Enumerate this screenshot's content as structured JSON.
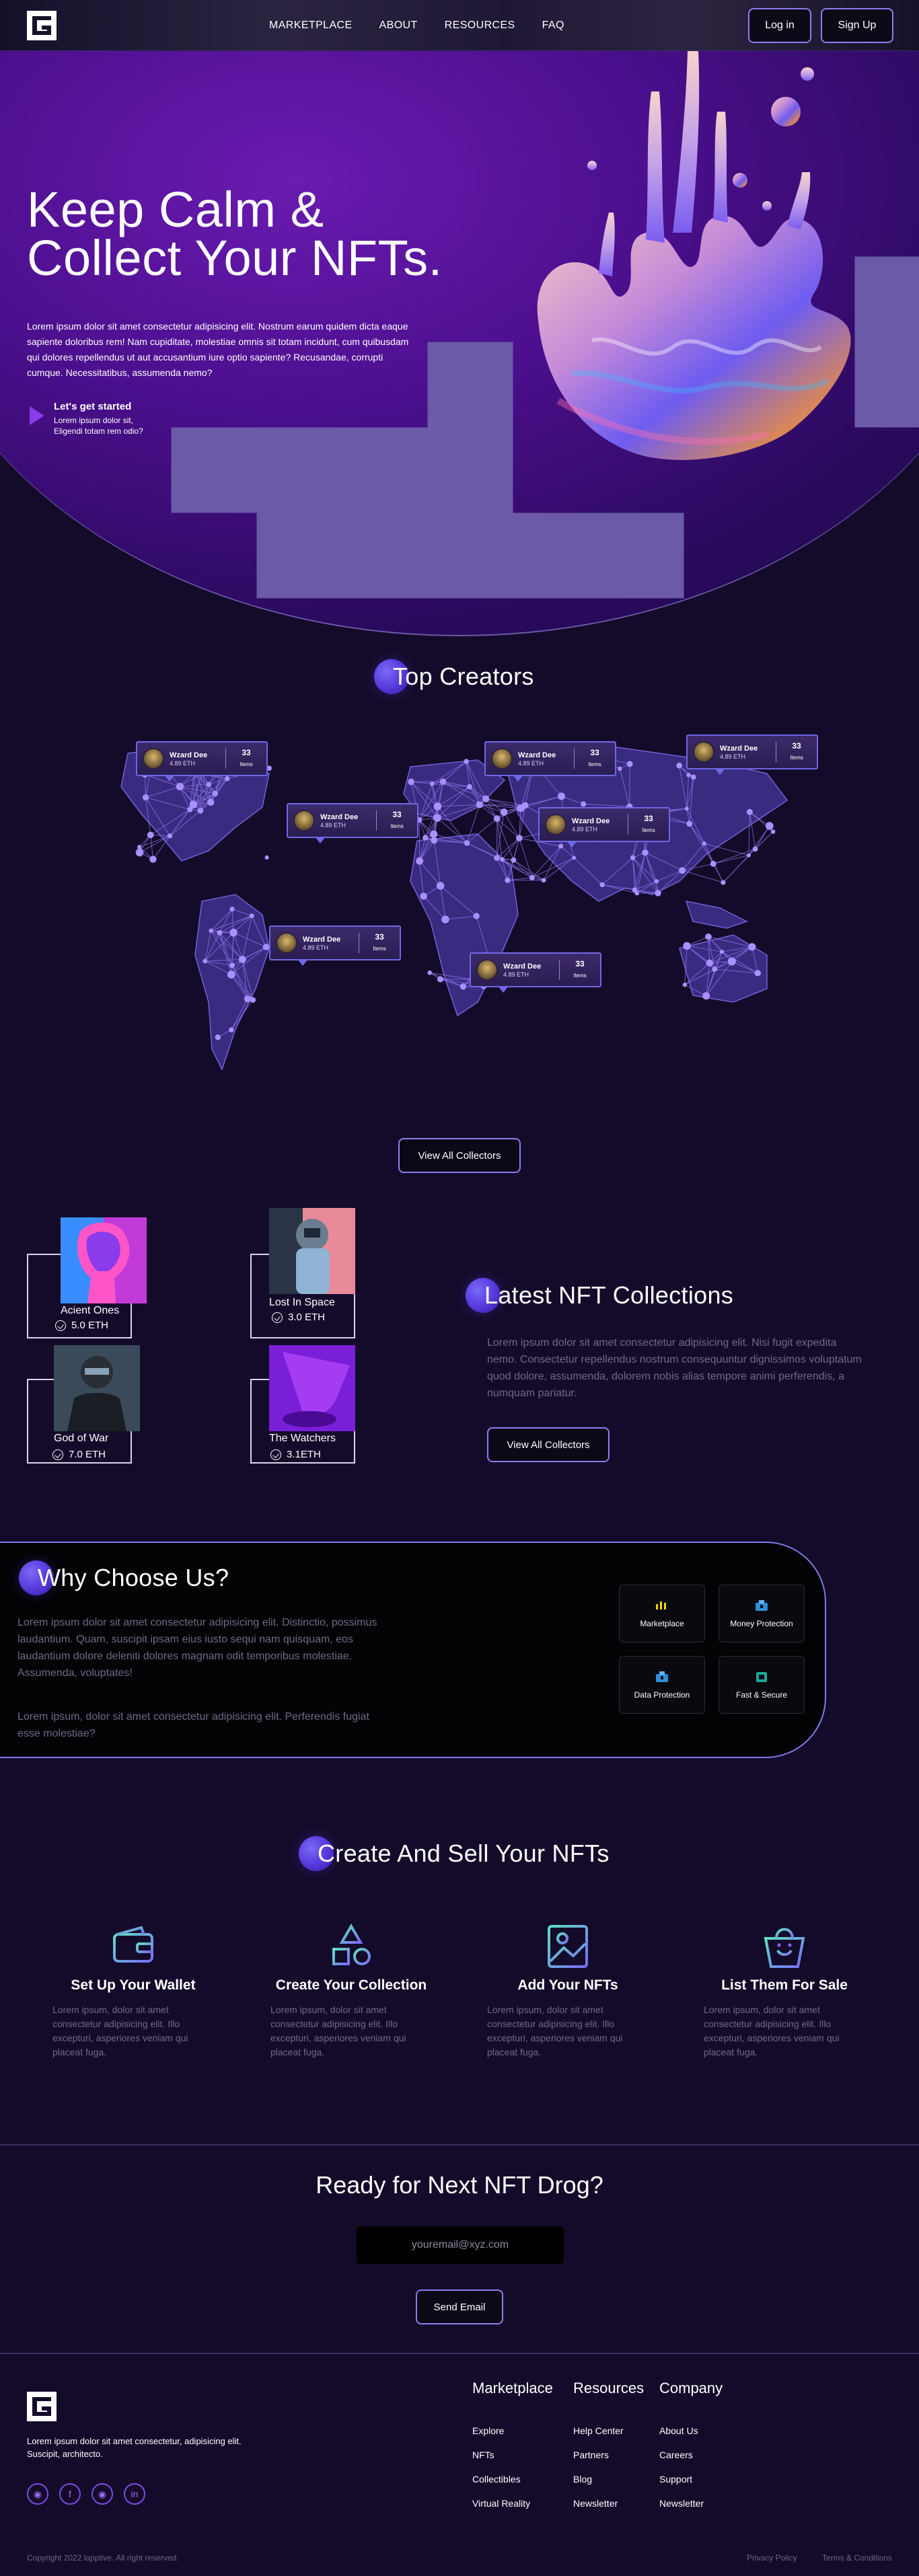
{
  "nav": {
    "items": [
      "MARKETPLACE",
      "ABOUT",
      "RESOURCES",
      "FAQ"
    ],
    "login": "Log in",
    "signup": "Sign Up"
  },
  "hero": {
    "title_line1": "Keep Calm &",
    "title_line2": "Collect Your NFTs.",
    "description": "Lorem ipsum dolor sit amet consectetur adipisicing elit. Nostrum earum quidem dicta eaque sapiente doloribus rem! Nam cupiditate, molestiae omnis sit totam incidunt, cum quibusdam qui dolores repellendus ut aut accusantium iure optio sapiente? Recusandae, corrupti cumque. Necessitatibus, assumenda nemo?",
    "cta_title": "Let's get started",
    "cta_sub": "Lorem ipsum dolor sit, Eligendi totam rem odio?"
  },
  "top_creators": {
    "title": "Top Creators",
    "cards": [
      {
        "name": "Wzard Dee",
        "eth": "4.89 ETH",
        "count": "33",
        "count_label": "Items"
      },
      {
        "name": "Wzard Dee",
        "eth": "4.89 ETH",
        "count": "33",
        "count_label": "Items"
      },
      {
        "name": "Wzard Dee",
        "eth": "4.89 ETH",
        "count": "33",
        "count_label": "Items"
      },
      {
        "name": "Wzard Dee",
        "eth": "4.89 ETH",
        "count": "33",
        "count_label": "Items"
      },
      {
        "name": "Wzard Dee",
        "eth": "4.89 ETH",
        "count": "33",
        "count_label": "Items"
      },
      {
        "name": "Wzard Dee",
        "eth": "4.89 ETH",
        "count": "33",
        "count_label": "Items"
      },
      {
        "name": "Wzard Dee",
        "eth": "4.89 ETH",
        "count": "33",
        "count_label": "Items"
      }
    ],
    "button": "View All Collectors"
  },
  "latest": {
    "title": "Latest NFT Collections",
    "description": "Lorem ipsum dolor sit amet consectetur adipisicing elit. Nisi fugit expedita nemo. Consectetur repellendus nostrum consequuntur dignissimos voluptatum quod dolore, assumenda, dolorem nobis alias tempore animi perferendis, a numquam pariatur.",
    "button": "View All Collectors",
    "nfts": [
      {
        "name": "Acient Ones",
        "eth": "5.0 ETH"
      },
      {
        "name": "Lost In Space",
        "eth": "3.0 ETH"
      },
      {
        "name": "God of War",
        "eth": "7.0 ETH"
      },
      {
        "name": "The Watchers",
        "eth": "3.1ETH"
      }
    ]
  },
  "why": {
    "title": "Why Choose Us?",
    "description": "Lorem ipsum dolor sit amet consectetur adipisicing elit. Distinctio, possimus laudantium. Quam, suscipit ipsam eius iusto sequi nam quisquam, eos laudantium dolore deleniti dolores magnam odit temporibus molestiae. Assumenda, voluptates!",
    "description2": "Lorem ipsum, dolor sit amet consectetur adipisicing elit. Perferendis fugiat esse molestiae?",
    "features": [
      "Marketplace",
      "Money Protection",
      "Data Protection",
      "Fast & Secure"
    ]
  },
  "create": {
    "title": "Create And Sell Your NFTs",
    "steps": [
      {
        "title": "Set Up Your Wallet",
        "text": "Lorem ipsum, dolor sit amet consectetur adipisicing elit. Illo excepturi, asperiores veniam qui placeat fuga."
      },
      {
        "title": "Create Your Collection",
        "text": "Lorem ipsum, dolor sit amet consectetur adipisicing elit. Illo excepturi, asperiores veniam qui placeat fuga."
      },
      {
        "title": "Add Your NFTs",
        "text": "Lorem ipsum, dolor sit amet consectetur adipisicing elit. Illo excepturi, asperiores veniam qui placeat fuga."
      },
      {
        "title": "List Them For Sale",
        "text": "Lorem ipsum, dolor sit amet consectetur adipisicing elit. Illo excepturi, asperiores veniam qui placeat fuga."
      }
    ]
  },
  "newsletter": {
    "title": "Ready for Next NFT Drog?",
    "placeholder": "youremail@xyz.com",
    "button": "Send Email"
  },
  "footer": {
    "about": "Lorem ipsum dolor sit amet consectetur, adipisicing elit. Suscipit, architecto.",
    "columns": [
      {
        "title": "Marketplace",
        "links": [
          "Explore",
          "NFTs",
          "Collectibles",
          "Virtual Reality"
        ]
      },
      {
        "title": "Resources",
        "links": [
          "Help Center",
          "Partners",
          "Blog",
          "Newsletter"
        ]
      },
      {
        "title": "Company",
        "links": [
          "About Us",
          "Careers",
          "Support",
          "Newsletter"
        ]
      }
    ],
    "copyright": "Copyright 2022 lapptive. All right reserved.",
    "privacy": "Privacy Policy",
    "terms": "Terms & Conditions"
  },
  "colors": {
    "accent": "#8f7df0",
    "hero_purple": "#4c0f8e",
    "background": "#140b2a"
  }
}
